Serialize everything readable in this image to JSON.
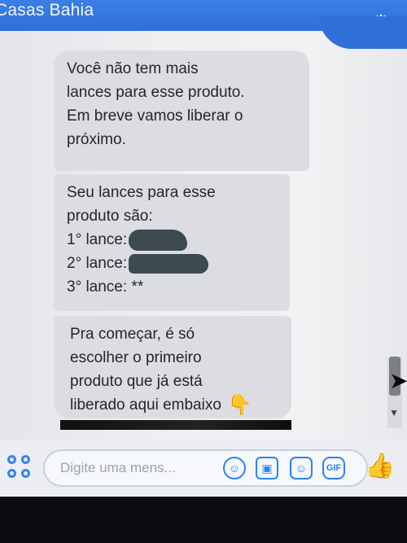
{
  "header": {
    "title": "Casas Bahia"
  },
  "messages": {
    "m1": [
      "Você não tem mais",
      "lances para esse produto.",
      "Em breve vamos liberar o",
      "próximo."
    ],
    "m2": {
      "intro": [
        "Seu lances para esse",
        "produto são:"
      ],
      "bids": [
        "1° lance:",
        "2° lance:",
        "3° lance: **"
      ]
    },
    "m3": [
      "Pra começar, é só",
      "escolher o primeiro",
      "produto que já está",
      "liberado aqui embaixo"
    ],
    "emoji": "👇"
  },
  "composer": {
    "placeholder": "Digite uma mens...",
    "gif_label": "GIF"
  },
  "icons": {
    "settings": "gear-icon",
    "apps": "apps-grid-icon",
    "emoji": "smiley-icon",
    "photo": "photo-icon",
    "sticker": "sticker-icon",
    "gif": "gif-icon",
    "like": "thumbs-up-icon",
    "pointing": "pointing-down-hand-icon"
  }
}
